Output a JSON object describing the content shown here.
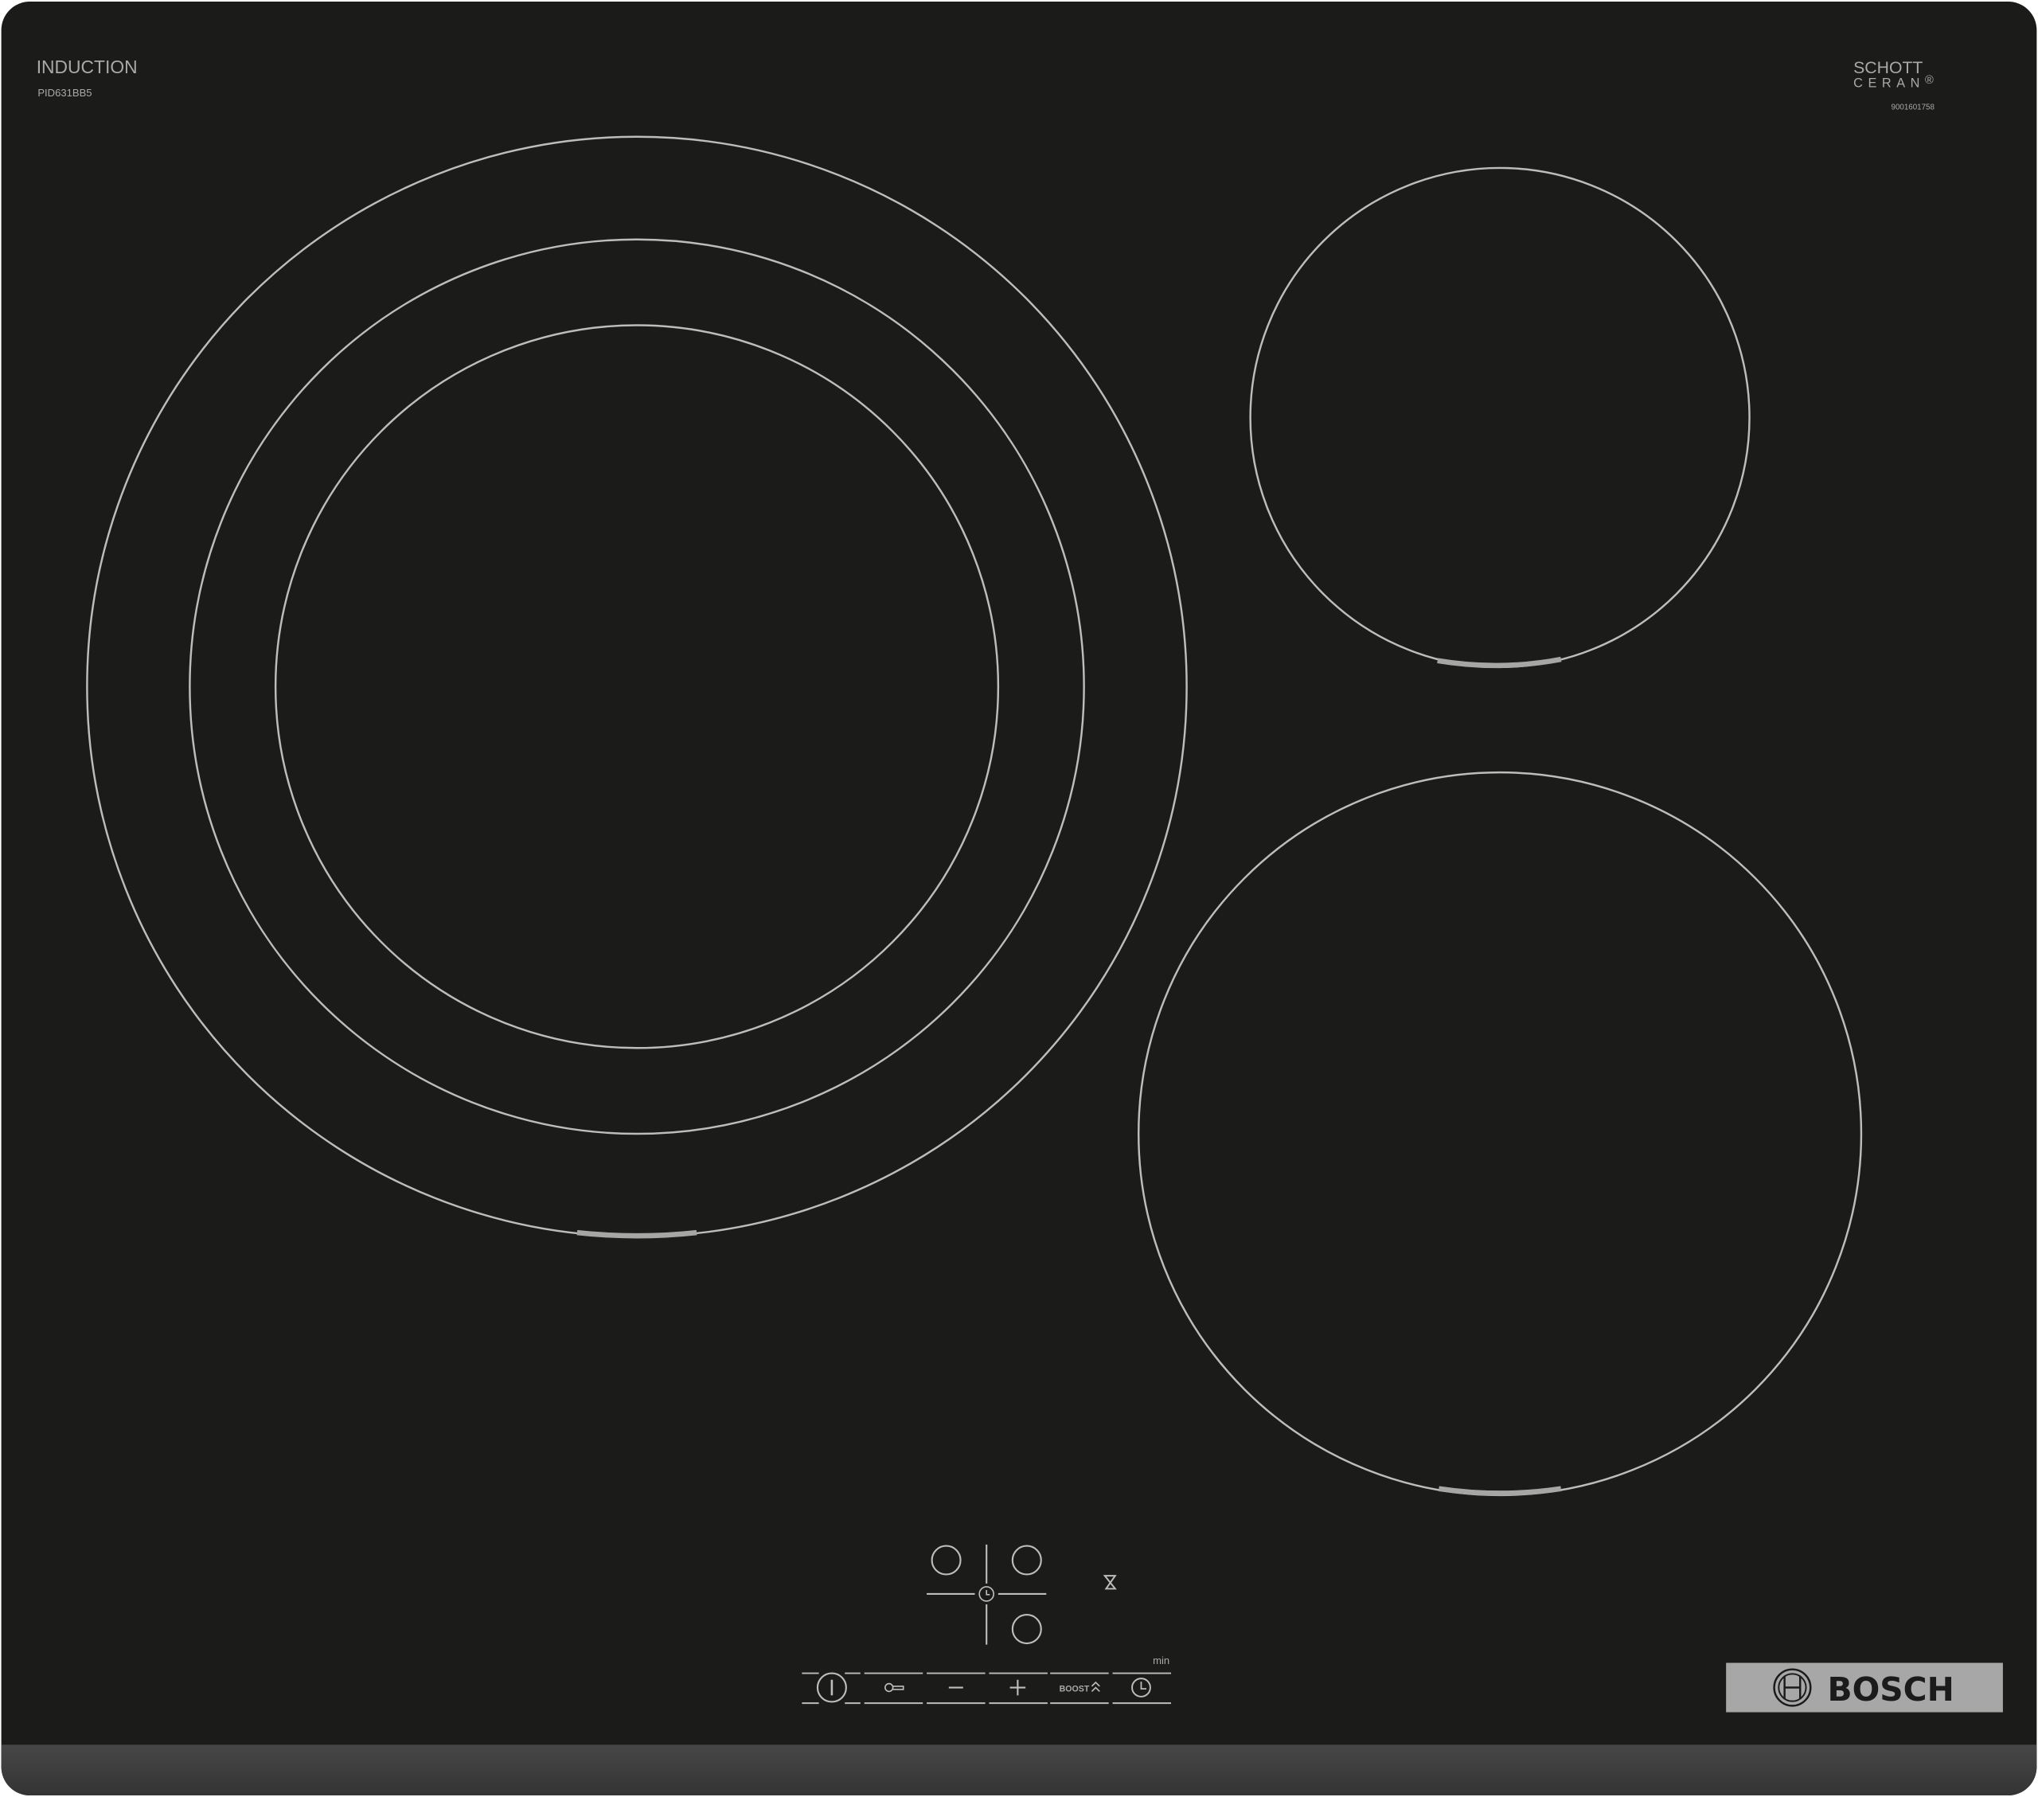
{
  "hob": {
    "type_label": "INDUCTION",
    "model": "PID631BB5",
    "glass_brand_line1": "SCHOTT",
    "glass_brand_line2": "CERAN",
    "registered_mark": "®",
    "serial": "9001601758",
    "brand": "BOSCH",
    "colors": {
      "glass": "#1b1b19",
      "edge": "#3d3d3d",
      "zone_line": "#c4c4c4",
      "badge": "#a7a7a7",
      "badge_text": "#1b1b1b"
    }
  },
  "zones": [
    {
      "name": "large-dual-zone",
      "rings": 3
    },
    {
      "name": "small-zone",
      "rings": 1
    },
    {
      "name": "medium-zone",
      "rings": 1
    }
  ],
  "controls": {
    "zone_selectors": [
      "zone-select-rear-left",
      "zone-select-rear-right",
      "zone-select-front-right"
    ],
    "timer_center_icon": "timer-icon",
    "hourglass_icon": "hourglass-icon",
    "min_label": "min",
    "buttons": [
      {
        "name": "power",
        "icon": "power-icon"
      },
      {
        "name": "child-lock",
        "icon": "key-icon"
      },
      {
        "name": "minus",
        "icon": "minus-icon"
      },
      {
        "name": "plus",
        "icon": "plus-icon"
      },
      {
        "name": "boost",
        "label": "BOOST",
        "icon": "double-chevron-up-icon"
      },
      {
        "name": "timer",
        "icon": "clock-icon"
      }
    ]
  }
}
